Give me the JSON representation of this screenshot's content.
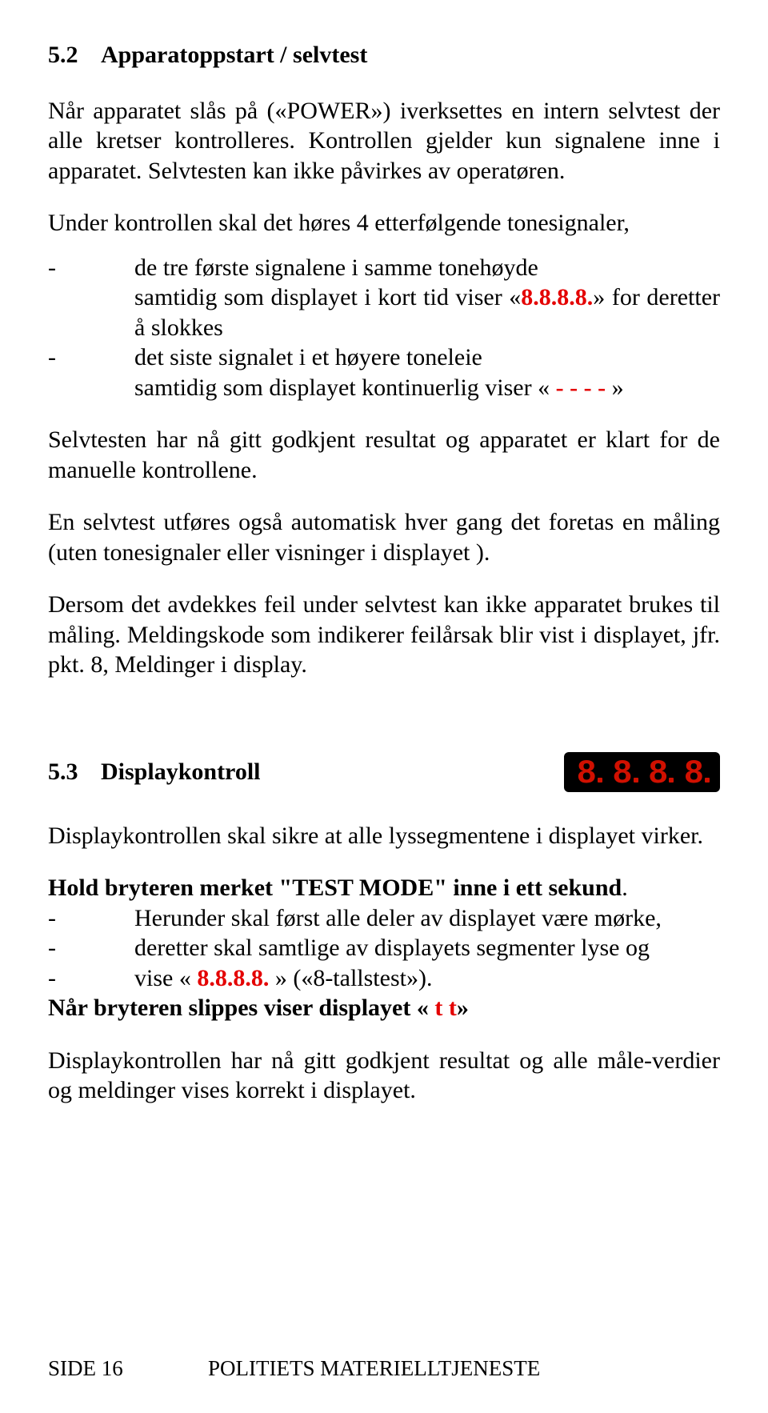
{
  "section52": {
    "num": "5.2",
    "title": "Apparatoppstart / selvtest",
    "p1": "Når apparatet slås på («POWER») iverksettes en intern selvtest der alle kretser kontrolleres. Kontrollen gjelder kun signalene inne i apparatet. Selvtesten kan ikke påvirkes av operatøren.",
    "p2": "Under kontrollen skal det høres 4 etterfølgende tonesignaler,",
    "b1a": "de tre første signalene i samme tonehøyde",
    "b1b_pre": "samtidig som displayet i kort tid viser «",
    "b1b_red": "8.8.8.8.",
    "b1b_post": "» for deretter å slokkes",
    "b2a": "det siste signalet i et høyere toneleie",
    "b2b_pre": "samtidig som displayet kontinuerlig viser «",
    "b2b_red": " - - - - ",
    "b2b_post": "»",
    "p3": "Selvtesten har nå gitt godkjent resultat og apparatet er klart for de manuelle kontrollene.",
    "p4": "En selvtest utføres også automatisk hver gang det foretas en måling (uten tonesignaler eller visninger i displayet ).",
    "p5": "Dersom det avdekkes feil under selvtest kan ikke apparatet brukes til måling. Meldingskode som indikerer feilårsak blir vist i displayet, jfr. pkt. 8, Meldinger i display."
  },
  "section53": {
    "num": "5.3",
    "title": "Displaykontroll",
    "p1": "Displaykontrollen skal sikre at alle lyssegmentene i displayet virker.",
    "bold1_pre": "Hold bryteren merket \"TEST MODE\" inne i ett sekund",
    "bold1_post": ".",
    "b1": "Herunder skal først alle deler av displayet være mørke,",
    "b2": "deretter skal samtlige av displayets segmenter lyse og",
    "b3_pre": "vise «",
    "b3_red": " 8.8.8.8. ",
    "b3_post": "» («8-tallstest»).",
    "bold2_pre": "Når bryteren slippes viser displayet «",
    "bold2_red": " t t",
    "bold2_post": "»",
    "p2": "Displaykontrollen har nå gitt godkjent resultat og alle måle-verdier og meldinger vises korrekt i displayet."
  },
  "footer": {
    "left": "SIDE 16",
    "right": "POLITIETS MATERIELLTJENESTE"
  },
  "display_digits": [
    "8",
    "8",
    "8",
    "8"
  ]
}
